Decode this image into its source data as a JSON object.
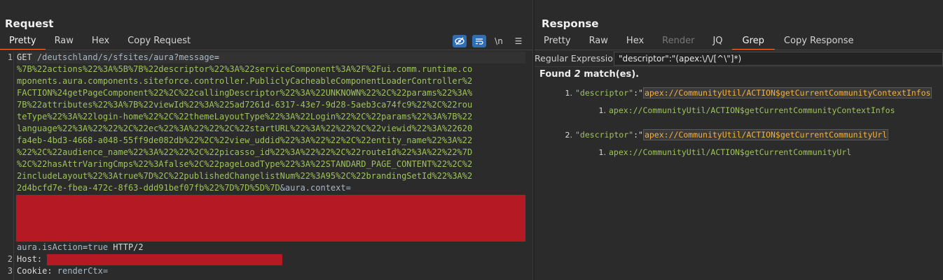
{
  "request": {
    "title": "Request",
    "tabs": [
      "Pretty",
      "Raw",
      "Hex",
      "Copy Request"
    ],
    "tools": {
      "newline_label": "\\n"
    },
    "lines": {
      "l1_a": "GET ",
      "l1_b": "/deutschland/s/sfsites/aura?",
      "l1_c": "message",
      "l1_d": "=",
      "w1": "%7B%22actions%22%3A%5B%7B%22descriptor%22%3A%22serviceComponent%3A%2F%2Fui.comm.runtime.co",
      "w2": "mponents.aura.components.siteforce.controller.PubliclyCacheableComponentLoaderController%2",
      "w3": "FACTION%24getPageComponent%22%2C%22callingDescriptor%22%3A%22UNKNOWN%22%2C%22params%22%3A%",
      "w4": "7B%22attributes%22%3A%7B%22viewId%22%3A%225ad7261d-6317-43e7-9d28-5aeb3ca74fc9%22%2C%22rou",
      "w5": "teType%22%3A%22login-home%22%2C%22themeLayoutType%22%3A%22Login%22%2C%22params%22%3A%7B%22",
      "w6": "language%22%3A%22%22%2C%22ec%22%3A%22%22%2C%22startURL%22%3A%22%22%2C%22viewid%22%3A%22620",
      "w7": "fa4eb-4bd3-4668-a048-55ff9de082db%22%2C%22view_uddid%22%3A%22%22%2C%22entity_name%22%3A%22",
      "w8": "%22%2C%22audience_name%22%3A%22%22%2C%22picasso_id%22%3A%22%22%2C%22routeId%22%3A%22%22%7D",
      "w9": "%2C%22hasAttrVaringCmps%22%3Afalse%2C%22pageLoadType%22%3A%22STANDARD_PAGE_CONTENT%22%2C%2",
      "w10": "2includeLayout%22%3Atrue%7D%2C%22publishedChangelistNum%22%3A95%2C%22brandingSetId%22%3A%2",
      "w11a": "2d4bcfd7e-fbea-472c-8f63-ddd91bef07fb%22%7D%7D%5D%7D",
      "w11b": "&aura.context=",
      "w12a": "aura.isAction",
      "w12b": "=",
      "w12c": "true",
      "w12d": " HTTP/2",
      "l2": "Host: ",
      "l3a": "Cookie: ",
      "l3b": "renderCtx="
    },
    "line_numbers": [
      "1",
      "2",
      "3"
    ]
  },
  "response": {
    "title": "Response",
    "tabs": [
      "Pretty",
      "Raw",
      "Hex",
      "Render",
      "JQ",
      "Grep",
      "Copy Response"
    ],
    "grep": {
      "label": "Regular Expression",
      "value": "\"descriptor\":\"(apex:\\/\\/[^\\\"]*)"
    },
    "found": {
      "prefix": "Found ",
      "count": "2",
      "suffix": " match(es)."
    },
    "matches": [
      {
        "num": "1.",
        "key": "\"descriptor\"",
        "colon": ":\"",
        "value": "apex://CommunityUtil/ACTION$getCurrentCommunityContextInfos",
        "sub_num": "1.",
        "sub": "apex://CommunityUtil/ACTION$getCurrentCommunityContextInfos"
      },
      {
        "num": "2.",
        "key": "\"descriptor\"",
        "colon": ":\"",
        "value": "apex://CommunityUtil/ACTION$getCurrentCommunityUrl",
        "sub_num": "1.",
        "sub": "apex://CommunityUtil/ACTION$getCurrentCommunityUrl"
      }
    ]
  },
  "colors": {
    "accent": "#ff6633",
    "redaction": "#b51a24",
    "code_green": "#9ec35a",
    "highlight": "#f5b041",
    "tool_blue": "#2f6eb5"
  },
  "icons": [
    "eye-off-icon",
    "wrap-lines-icon",
    "newline-icon",
    "menu-icon"
  ]
}
